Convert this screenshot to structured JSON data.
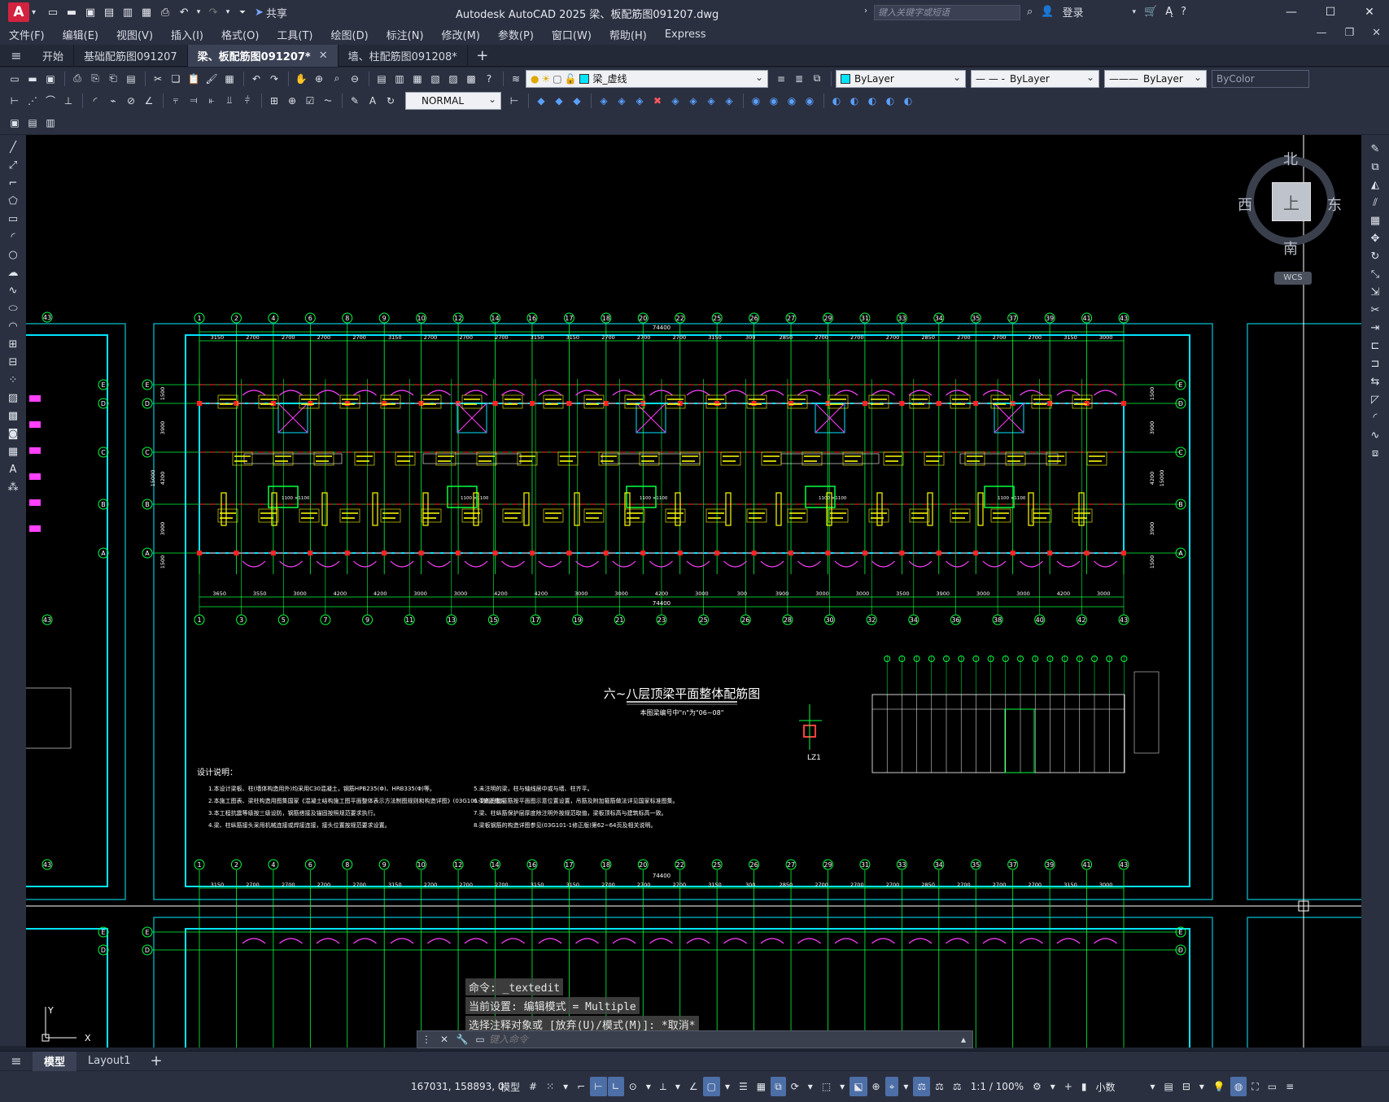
{
  "titlebar": {
    "app_title": "Autodesk AutoCAD 2025    梁、板配筋图091207.dwg",
    "share_label": "共享",
    "search_placeholder": "键入关键字或短语",
    "login_label": "登录"
  },
  "menu": [
    "文件(F)",
    "编辑(E)",
    "视图(V)",
    "插入(I)",
    "格式(O)",
    "工具(T)",
    "绘图(D)",
    "标注(N)",
    "修改(M)",
    "参数(P)",
    "窗口(W)",
    "帮助(H)",
    "Express"
  ],
  "file_tabs": [
    {
      "label": "开始",
      "active": false,
      "closable": false
    },
    {
      "label": "基础配筋图091207",
      "active": false,
      "closable": false
    },
    {
      "label": "梁、板配筋图091207*",
      "active": true,
      "closable": true
    },
    {
      "label": "墙、柱配筋图091208*",
      "active": false,
      "closable": false
    }
  ],
  "toolbar": {
    "layer_name": "梁_虚线",
    "color": "ByLayer",
    "linetype": "ByLayer",
    "lineweight": "ByLayer",
    "plotstyle": "ByColor",
    "textstyle": "NORMAL"
  },
  "viewcube": {
    "north": "北",
    "south": "南",
    "east": "东",
    "west": "西",
    "face": "上",
    "wcs": "WCS"
  },
  "drawing": {
    "title": "六~八层顶梁平面整体配筋图",
    "subtitle": "本图梁编号中\"n\"为\"06~08\"",
    "notes_heading": "设计说明：",
    "notes_left": [
      "1.本设计梁板、柱(墙体构造用外)均采用C30混凝土，钢筋HPB235(Φ)、HRB335(Φ)等。",
      "2.本施工图表、梁柱构造用图集国家《混凝土结构施工图平面整体表示方法制图规则和构造详图》(03G101-1修正版)。",
      "3.本工程抗震等级按三级设防，钢筋搭接及锚固按照规范要求执行。",
      "4.梁、柱纵筋接头采用机械连接或焊接连接，接头位置按规范要求设置。"
    ],
    "notes_right": [
      "5.未注明的梁，柱与轴线居中或与墙、柱齐平。",
      "6.梁的附加箍筋按平面图示意位置设置，吊筋及附加箍筋做法详见国家标准图集。",
      "7.梁、柱纵筋保护层厚度除注明外按规范取值，梁板顶标高与建筑标高一致。",
      "8.梁板钢筋的构造详图参见(03G101-1修正版)第62~64页及相关说明。"
    ],
    "total_dim": "74400",
    "axes_top": [
      "1",
      "2",
      "4",
      "6",
      "8",
      "9",
      "10",
      "12",
      "14",
      "16",
      "17",
      "18",
      "20",
      "22",
      "25",
      "26",
      "27",
      "29",
      "31",
      "33",
      "34",
      "35",
      "37",
      "39",
      "41",
      "43"
    ],
    "axes_bottom": [
      "1",
      "3",
      "5",
      "7",
      "9",
      "11",
      "13",
      "15",
      "17",
      "19",
      "21",
      "23",
      "25",
      "26",
      "28",
      "30",
      "32",
      "34",
      "36",
      "38",
      "40",
      "42",
      "43"
    ],
    "axes_side": [
      "E",
      "D",
      "C",
      "B",
      "A"
    ],
    "dims_top": [
      "3150",
      "2700",
      "2700",
      "2700",
      "2700",
      "3150",
      "2700",
      "2700",
      "2700",
      "3150",
      "3150",
      "2700",
      "2700",
      "2700",
      "3150",
      "300",
      "2850",
      "2700",
      "2700",
      "2700",
      "2850",
      "2700",
      "2700",
      "2700",
      "3150",
      "3000"
    ],
    "dims_bottom": [
      "3650",
      "3550",
      "3000",
      "4200",
      "4200",
      "3000",
      "3000",
      "4200",
      "4200",
      "3000",
      "3000",
      "4200",
      "3000",
      "300",
      "3900",
      "3000",
      "3000",
      "3500",
      "3900",
      "3000",
      "3000",
      "4200",
      "3000"
    ],
    "dims_side": [
      "1500",
      "3900",
      "15000",
      "4200",
      "3900",
      "1500"
    ],
    "column_label": "LZ1"
  },
  "command": {
    "history": [
      "命令: _textedit",
      "当前设置: 编辑模式 = Multiple",
      "选择注释对象或 [放弃(U)/模式(M)]: *取消*"
    ],
    "placeholder": "键入命令"
  },
  "layout_tabs": [
    "模型",
    "Layout1"
  ],
  "status": {
    "coords": "167031, 158893, 0",
    "model": "模型",
    "scale": "1:1 / 100%",
    "units": "小数"
  }
}
